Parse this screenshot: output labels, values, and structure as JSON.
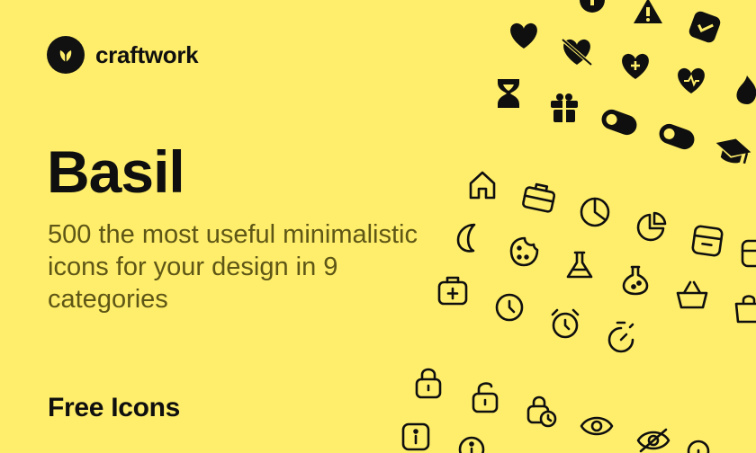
{
  "brand": {
    "name": "craftwork",
    "logo_icon": "leaf-logo-icon"
  },
  "hero": {
    "title": "Basil",
    "subtitle": "500 the most useful minimalistic icons for your design in 9 categories"
  },
  "footer": {
    "label": "Free Icons"
  },
  "colors": {
    "background": "#FFEE6B",
    "ink": "#0F0F0F",
    "subtitle": "#5E5616"
  },
  "icons": [
    "info-circle-icon",
    "warning-triangle-icon",
    "checkbox-icon",
    "heart-icon",
    "heart-slash-icon",
    "heart-plus-icon",
    "heart-pulse-icon",
    "flame-icon",
    "hourglass-icon",
    "gift-icon",
    "toggle-on-icon",
    "toggle-off-icon",
    "graduation-cap-icon",
    "home-icon",
    "briefcase-icon",
    "pie-chart-icon",
    "pie-chart-2-icon",
    "archive-icon",
    "box-icon",
    "moon-icon",
    "cookie-icon",
    "flask-icon",
    "potion-icon",
    "basket-icon",
    "shopping-bag-icon",
    "medical-kit-icon",
    "clock-icon",
    "alarm-clock-icon",
    "stopwatch-icon",
    "lock-icon",
    "unlock-icon",
    "lock-time-icon",
    "eye-icon",
    "eye-slash-icon",
    "info-square-icon",
    "info-outline-icon",
    "info-small-icon"
  ]
}
